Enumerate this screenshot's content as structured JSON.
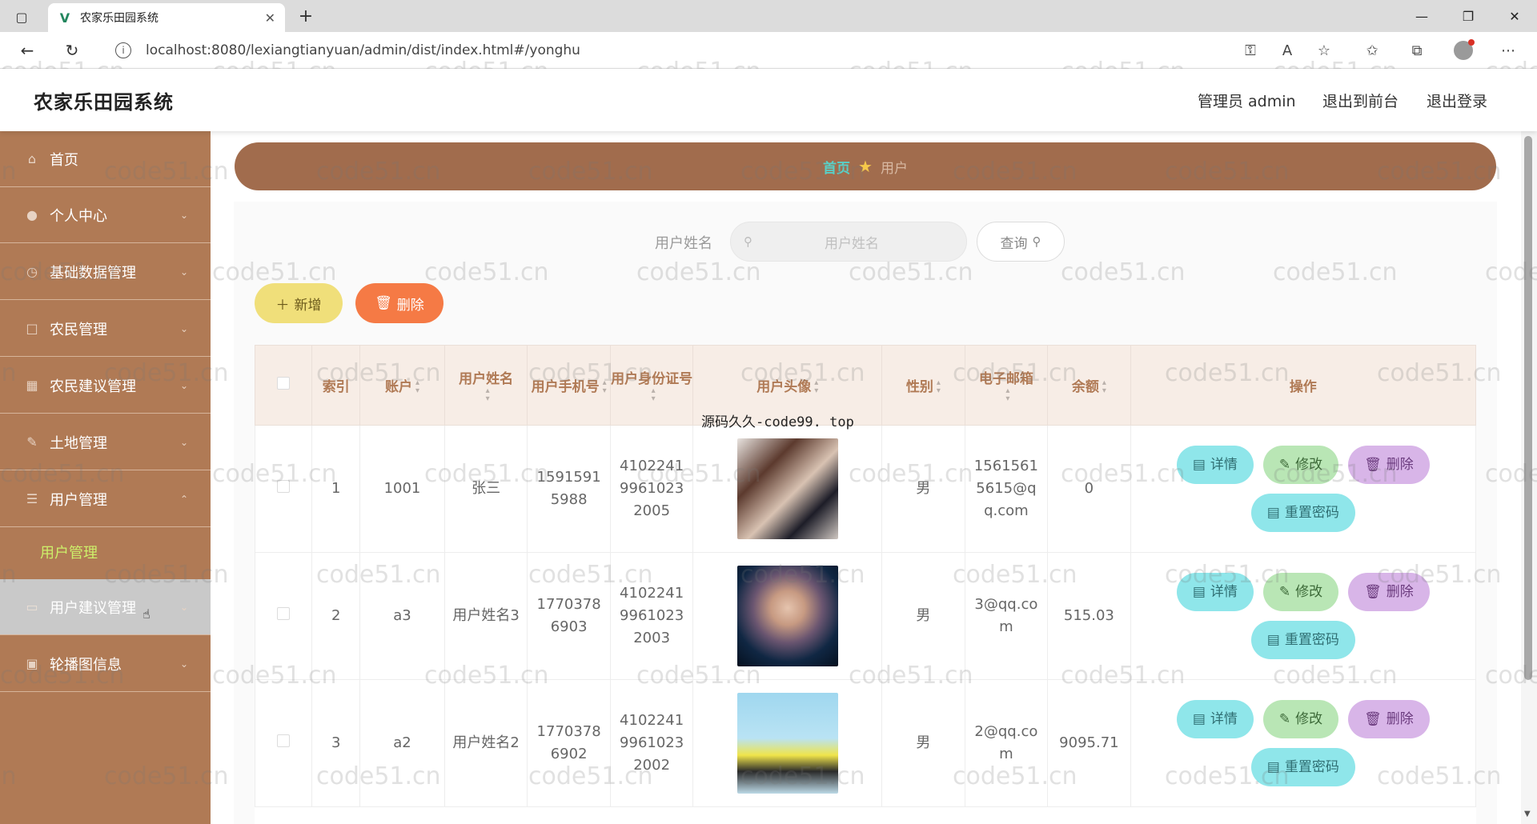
{
  "browser": {
    "tab_title": "农家乐田园系统",
    "url": "localhost:8080/lexiangtianyuan/admin/dist/index.html#/yonghu"
  },
  "header": {
    "app_title": "农家乐田园系统",
    "admin_label": "管理员 admin",
    "front_link": "退出到前台",
    "logout_link": "退出登录"
  },
  "sidebar": {
    "items": [
      {
        "label": "首页",
        "icon": "home-icon"
      },
      {
        "label": "个人中心",
        "icon": "user-icon"
      },
      {
        "label": "基础数据管理",
        "icon": "clock-icon"
      },
      {
        "label": "农民管理",
        "icon": "square-icon"
      },
      {
        "label": "农民建议管理",
        "icon": "building-icon"
      },
      {
        "label": "土地管理",
        "icon": "pen-icon"
      },
      {
        "label": "用户管理",
        "icon": "list-icon"
      },
      {
        "label": "用户建议管理",
        "icon": "monitor-icon"
      },
      {
        "label": "轮播图信息",
        "icon": "image-icon"
      }
    ],
    "submenu_active": "用户管理"
  },
  "breadcrumb": {
    "home": "首页",
    "current": "用户"
  },
  "search": {
    "label": "用户姓名",
    "placeholder": "用户姓名",
    "button": "查询"
  },
  "actions": {
    "add": "新增",
    "delete": "删除"
  },
  "overlay_text": "源码久久-code99. top",
  "watermark": "code51.cn",
  "table": {
    "headers": {
      "index": "索引",
      "account": "账户",
      "name": "用户姓名",
      "phone": "用户手机号",
      "id_card": "用户身份证号",
      "avatar": "用户头像",
      "gender": "性别",
      "email": "电子邮箱",
      "balance": "余额",
      "ops": "操作"
    },
    "rows": [
      {
        "index": "1",
        "account": "1001",
        "name": "张三",
        "phone": "15915915988",
        "id_card": "410224199610232005",
        "gender": "男",
        "email": "15615615615@qq.com",
        "balance": "0"
      },
      {
        "index": "2",
        "account": "a3",
        "name": "用户姓名3",
        "phone": "17703786903",
        "id_card": "410224199610232003",
        "gender": "男",
        "email": "3@qq.com",
        "balance": "515.03"
      },
      {
        "index": "3",
        "account": "a2",
        "name": "用户姓名2",
        "phone": "17703786902",
        "id_card": "410224199610232002",
        "gender": "男",
        "email": "2@qq.com",
        "balance": "9095.71"
      }
    ],
    "row_buttons": {
      "detail": "详情",
      "edit": "修改",
      "delete": "删除",
      "reset": "重置密码"
    }
  }
}
